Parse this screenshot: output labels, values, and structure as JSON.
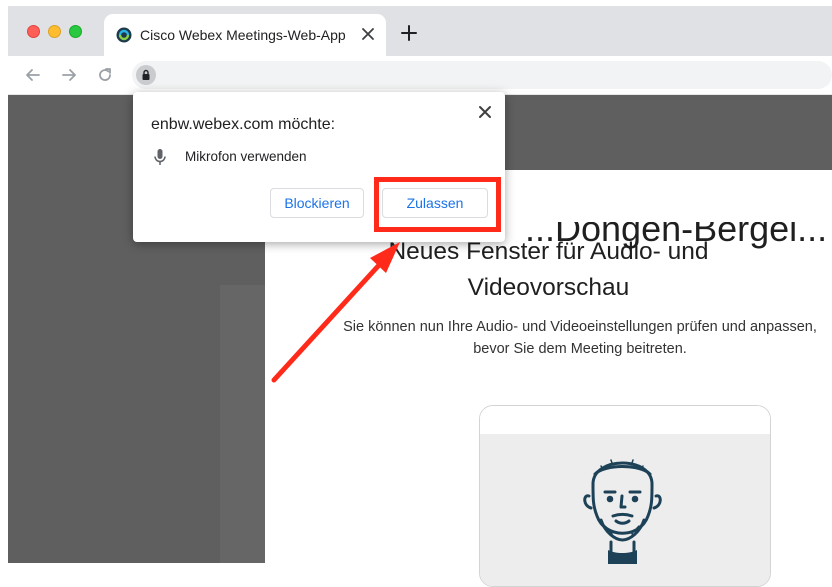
{
  "browser": {
    "tab": {
      "title": "Cisco Webex Meetings-Web-App",
      "favicon": "webex-icon",
      "close_icon": "close-icon"
    },
    "new_tab_icon": "plus-icon",
    "nav": {
      "back_icon": "arrow-left-icon",
      "forward_icon": "arrow-right-icon",
      "reload_icon": "reload-icon"
    },
    "address_bar": {
      "lock_icon": "lock-icon"
    }
  },
  "permission_popup": {
    "title": "enbw.webex.com möchte:",
    "permission_icon": "microphone-icon",
    "permission_label": "Mikrofon verwenden",
    "block_label": "Blockieren",
    "allow_label": "Zulassen",
    "close_icon": "close-icon"
  },
  "page": {
    "background_heading_fragment": "...Dongen-Bergel...",
    "heading_line1": "Neues Fenster für Audio- und",
    "heading_line2": "Videovorschau",
    "description": "Sie können nun Ihre Audio- und Videoeinstellungen prüfen und anpassen, bevor Sie dem Meeting beitreten.",
    "avatar_icon": "user-avatar-icon"
  },
  "annotation": {
    "color": "#ff2a1a",
    "arrow_icon": "arrow-icon"
  },
  "colors": {
    "tabstrip": "#dfe1e5",
    "page_overlay": "#5f5f5f",
    "link_blue": "#1a73e8",
    "avatar_stroke": "#1d4258"
  }
}
